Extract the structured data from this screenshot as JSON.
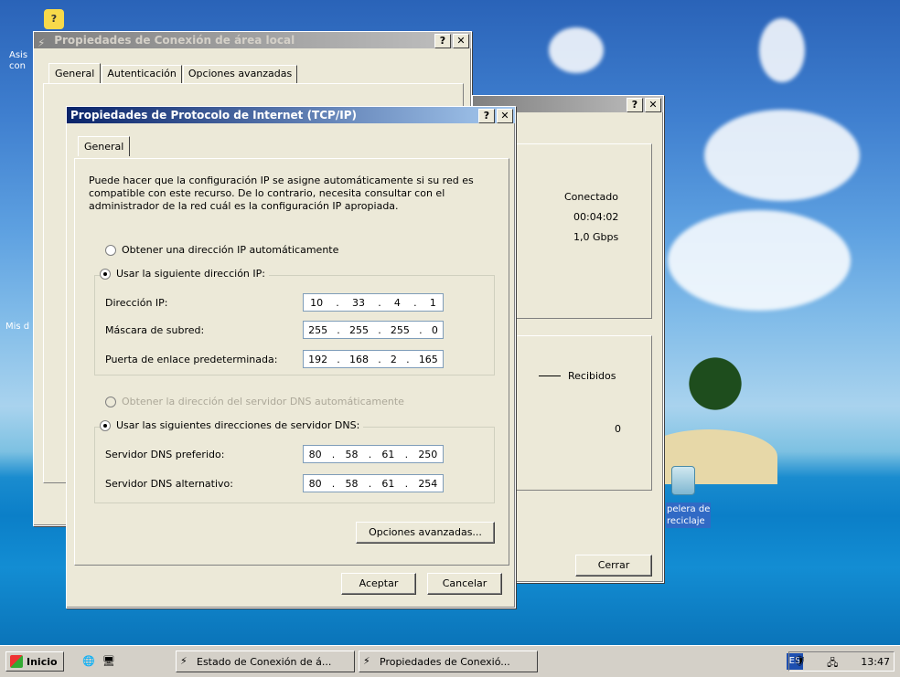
{
  "windows": {
    "lan_props": {
      "title": "Propiedades de Conexión de área local",
      "tabs": [
        "General",
        "Autenticación",
        "Opciones avanzadas"
      ]
    },
    "status": {
      "items": {
        "state": "Conectado",
        "duration": "00:04:02",
        "speed": "1,0 Gbps",
        "received_label": "Recibidos",
        "received_value": "0"
      },
      "close_label": "Cerrar"
    },
    "tcpip": {
      "title": "Propiedades de Protocolo de Internet (TCP/IP)",
      "tab": "General",
      "intro": "Puede hacer que la configuración IP se asigne automáticamente si su red es compatible con este recurso. De lo contrario, necesita consultar con el administrador de la red cuál es la configuración IP apropiada.",
      "auto_ip": "Obtener una dirección IP automáticamente",
      "use_ip": "Usar la siguiente dirección IP:",
      "ip_label": "Dirección IP:",
      "mask_label": "Máscara de subred:",
      "gateway_label": "Puerta de enlace predeterminada:",
      "ip_value": [
        "10",
        "33",
        "4",
        "1"
      ],
      "mask_value": [
        "255",
        "255",
        "255",
        "0"
      ],
      "gateway_value": [
        "192",
        "168",
        "2",
        "165"
      ],
      "auto_dns": "Obtener la dirección del servidor DNS automáticamente",
      "use_dns": "Usar las siguientes direcciones de servidor DNS:",
      "dns1_label": "Servidor DNS preferido:",
      "dns2_label": "Servidor DNS alternativo:",
      "dns1_value": [
        "80",
        "58",
        "61",
        "250"
      ],
      "dns2_value": [
        "80",
        "58",
        "61",
        "254"
      ],
      "advanced": "Opciones avanzadas...",
      "ok": "Aceptar",
      "cancel": "Cancelar"
    }
  },
  "desktop": {
    "recycle_bin": [
      "pelera de",
      "reciclaje"
    ],
    "left_labels": [
      "Asis",
      "con",
      "Mis d"
    ]
  },
  "taskbar": {
    "start": "Inicio",
    "tasks": [
      "Estado de Conexión de á...",
      "Propiedades de Conexió..."
    ],
    "lang": "ES",
    "time": "13:47"
  },
  "colors": {
    "title_active": "#0a246a",
    "window_bg": "#ece9d8"
  }
}
